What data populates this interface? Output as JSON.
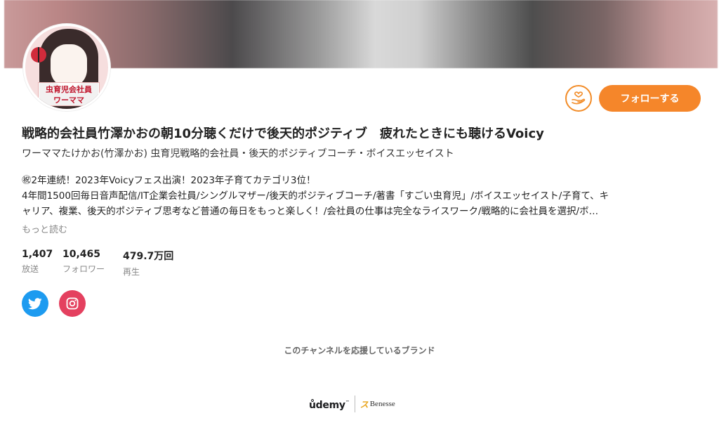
{
  "channel": {
    "title": "戦略的会社員竹澤かおの朝10分聴くだけで後天的ポジティブ　疲れたときにも聴けるVoicy",
    "subtitle": "ワーママたけかお(竹澤かお) 虫育児戦略的会社員・後天的ポジティブコーチ・ボイスエッセイスト",
    "avatar_tag_line1": "虫育児会社員",
    "avatar_tag_line2": "ワーママ",
    "description_lines": [
      "㊗2年連続！2023年Voicyフェス出演！2023年子育てカテゴリ3位！",
      "4年間1500回毎日音声配信/IT企業会社員/シングルマザー/後天的ポジティブコーチ/著書「すごい虫育児」/ボイスエッセイスト/子育て、キ",
      "ャリア、複業、後天的ポジティブ思考など普通の毎日をもっと楽しく！/会社員の仕事は完全なライスワーク/戦略的に会社員を選択/ボ…"
    ],
    "more_label": "もっと読む"
  },
  "actions": {
    "follow_label": "フォローする",
    "support_icon": "hand-heart-icon"
  },
  "stats": [
    {
      "value": "1,407",
      "label": "放送"
    },
    {
      "value": "10,465",
      "label": "フォロワー"
    },
    {
      "value": "479.7万回",
      "label": "再生"
    }
  ],
  "sns": {
    "twitter_icon": "twitter-icon",
    "instagram_icon": "instagram-icon"
  },
  "brands": {
    "label": "このチャンネルを応援しているブランド",
    "udemy": "ůdemy",
    "udemy_tm": "™",
    "benesse_mark": "ス",
    "benesse_name": "Benesse"
  },
  "colors": {
    "accent": "#f5862a",
    "twitter": "#1d9bf0",
    "instagram": "#e4405f"
  }
}
